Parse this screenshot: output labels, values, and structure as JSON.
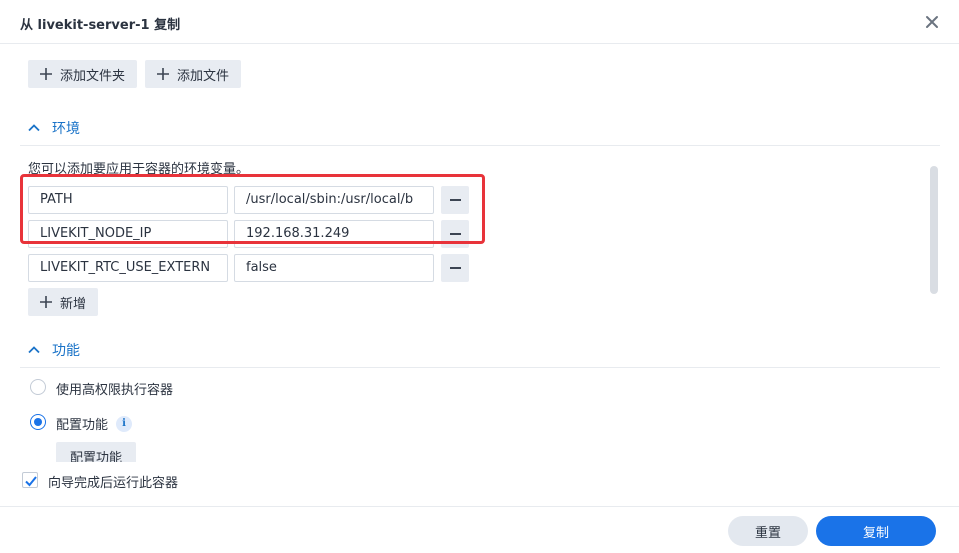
{
  "dialog": {
    "title": "从 livekit-server-1 复制"
  },
  "toolbar": {
    "add_folder_label": "添加文件夹",
    "add_file_label": "添加文件"
  },
  "environment": {
    "header": "环境",
    "description": "您可以添加要应用于容器的环境变量。",
    "rows": [
      {
        "key": "PATH",
        "value": "/usr/local/sbin:/usr/local/b"
      },
      {
        "key": "LIVEKIT_NODE_IP",
        "value": "192.168.31.249"
      },
      {
        "key": "LIVEKIT_RTC_USE_EXTERN",
        "value": "false"
      }
    ],
    "add_label": "新增"
  },
  "capabilities": {
    "header": "功能",
    "options": [
      {
        "label": "使用高权限执行容器",
        "checked": false
      },
      {
        "label": "配置功能",
        "checked": true
      }
    ],
    "configure_button_label": "配置功能",
    "info_glyph": "i"
  },
  "run_after_wizard": {
    "label": "向导完成后运行此容器",
    "checked": true
  },
  "footer": {
    "reset_label": "重置",
    "copy_label": "复制"
  },
  "colors": {
    "accent": "#1a73e8",
    "highlight_border": "#e8333a"
  }
}
